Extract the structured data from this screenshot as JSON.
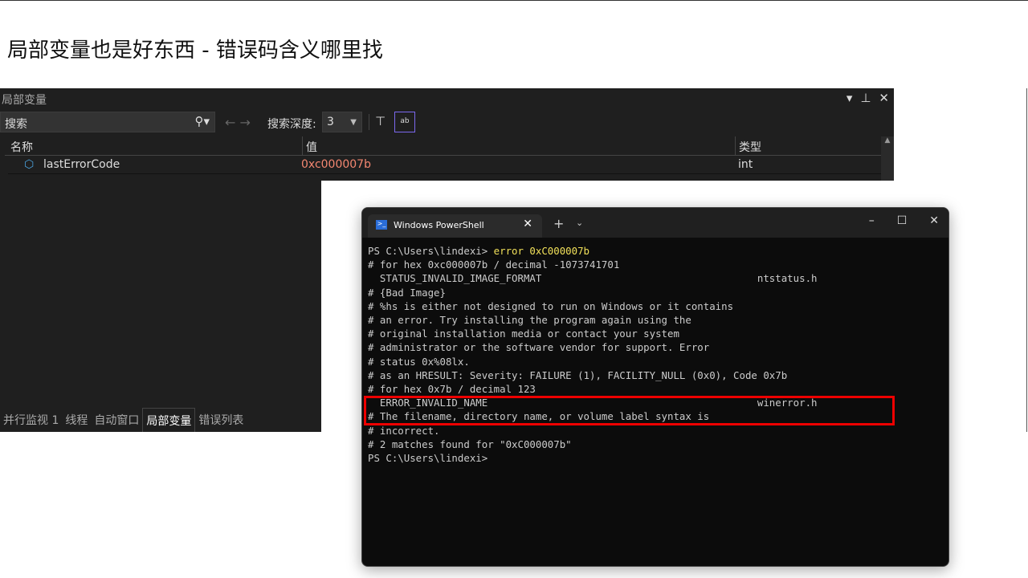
{
  "slide_title": "局部变量也是好东西 - 错误码含义哪里找",
  "vs": {
    "panel_title": "局部变量",
    "search_placeholder": "搜索",
    "depth_label": "搜索深度:",
    "depth_value": "3",
    "columns": [
      "名称",
      "值",
      "类型"
    ],
    "rows": [
      {
        "name": "lastErrorCode",
        "value": "0xc000007b",
        "type": "int"
      }
    ],
    "value_color": "#f48771",
    "bottom_tabs": [
      "并行监视 1",
      "线程",
      "自动窗口",
      "局部变量",
      "错误列表"
    ],
    "active_tab": "局部变量"
  },
  "terminal": {
    "tab_title": "Windows PowerShell",
    "prompt": "PS C:\\Users\\lindexi> ",
    "command": "error 0xC000007b",
    "lines": [
      "# for hex 0xc000007b / decimal -1073741701",
      "  STATUS_INVALID_IMAGE_FORMAT                                    ntstatus.h",
      "# {Bad Image}",
      "# %hs is either not designed to run on Windows or it contains",
      "# an error. Try installing the program again using the",
      "# original installation media or contact your system",
      "# administrator or the software vendor for support. Error",
      "# status 0x%08lx.",
      "# as an HRESULT: Severity: FAILURE (1), FACILITY_NULL (0x0), Code 0x7b",
      "# for hex 0x7b / decimal 123",
      "  ERROR_INVALID_NAME                                             winerror.h",
      "# The filename, directory name, or volume label syntax is",
      "# incorrect.",
      "# 2 matches found for \"0xC000007b\"",
      "PS C:\\Users\\lindexi>"
    ],
    "highlight_color": "#e00000"
  }
}
